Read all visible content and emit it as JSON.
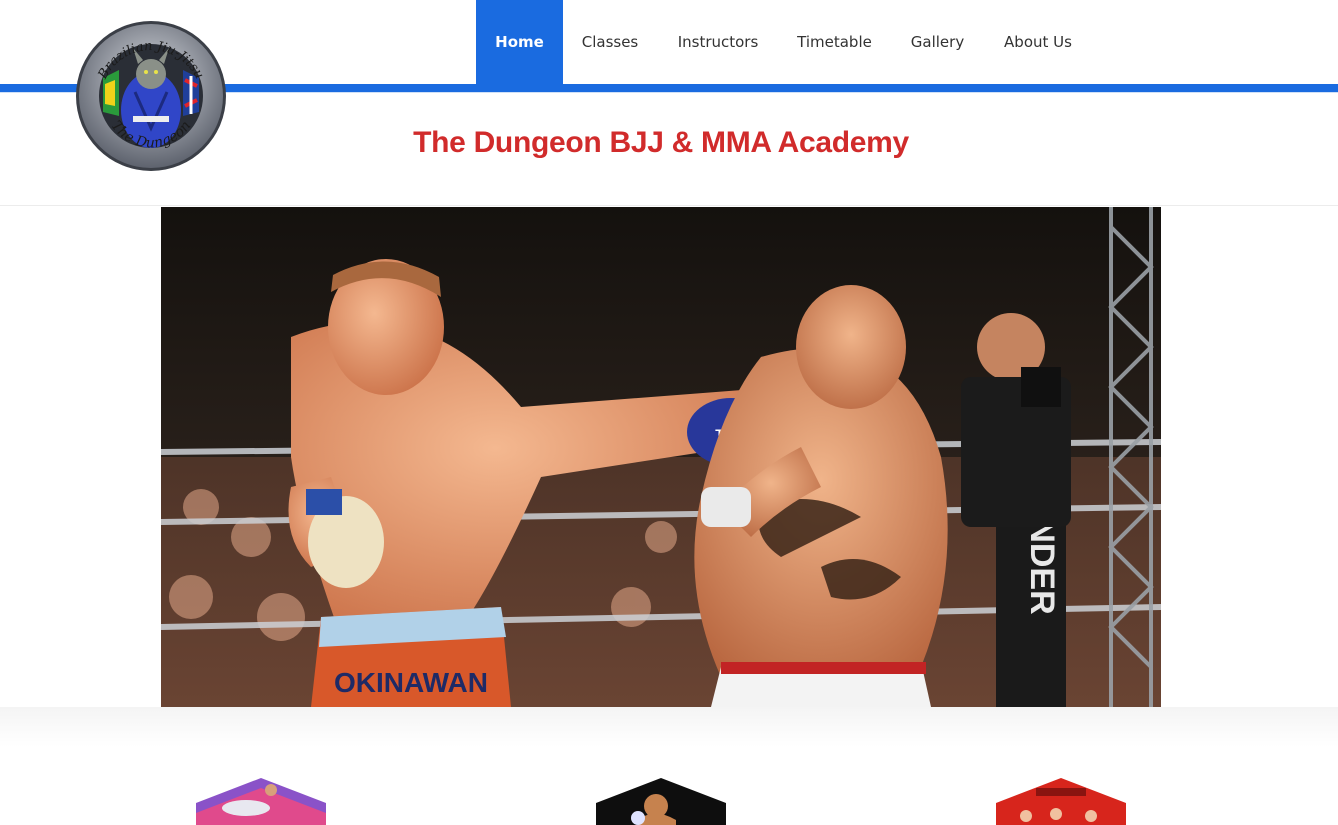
{
  "nav": {
    "items": [
      {
        "label": "Home",
        "active": true
      },
      {
        "label": "Classes",
        "active": false
      },
      {
        "label": "Instructors",
        "active": false
      },
      {
        "label": "Timetable",
        "active": false
      },
      {
        "label": "Gallery",
        "active": false
      },
      {
        "label": "About Us",
        "active": false
      }
    ]
  },
  "logo": {
    "top_text": "Brazilian Jiu-Jitsu",
    "bottom_text": "The Dungeon"
  },
  "site": {
    "title": "The Dungeon BJJ & MMA Academy"
  },
  "hero": {
    "corner_post_text": "CONTENDER",
    "shorts_text": "OKINAWAN",
    "glove_text": "TAKI"
  },
  "colors": {
    "accent": "#1a6be0",
    "title": "#d12b2b",
    "nav_text": "#333333"
  },
  "features": [
    {
      "name": "thumb-bjj"
    },
    {
      "name": "thumb-mma"
    },
    {
      "name": "thumb-kids"
    }
  ]
}
